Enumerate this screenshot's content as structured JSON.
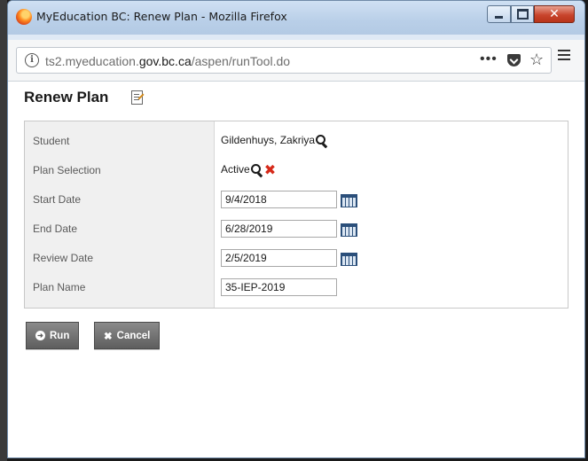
{
  "window": {
    "title": "MyEducation BC: Renew Plan - Mozilla Firefox"
  },
  "browser": {
    "url_host_prefix": "ts2.myeducation.",
    "url_host_domain": "gov.bc.ca",
    "url_path": "/aspen/runTool.do",
    "more_label": "•••"
  },
  "page": {
    "title": "Renew Plan"
  },
  "form": {
    "student": {
      "label": "Student",
      "value": "Gildenhuys, Zakriya"
    },
    "plan_selection": {
      "label": "Plan Selection",
      "value": "Active"
    },
    "start_date": {
      "label": "Start Date",
      "value": "9/4/2018"
    },
    "end_date": {
      "label": "End Date",
      "value": "6/28/2019"
    },
    "review_date": {
      "label": "Review Date",
      "value": "2/5/2019"
    },
    "plan_name": {
      "label": "Plan Name",
      "value": "35-IEP-2019"
    }
  },
  "actions": {
    "run_label": "Run",
    "cancel_label": "Cancel"
  }
}
